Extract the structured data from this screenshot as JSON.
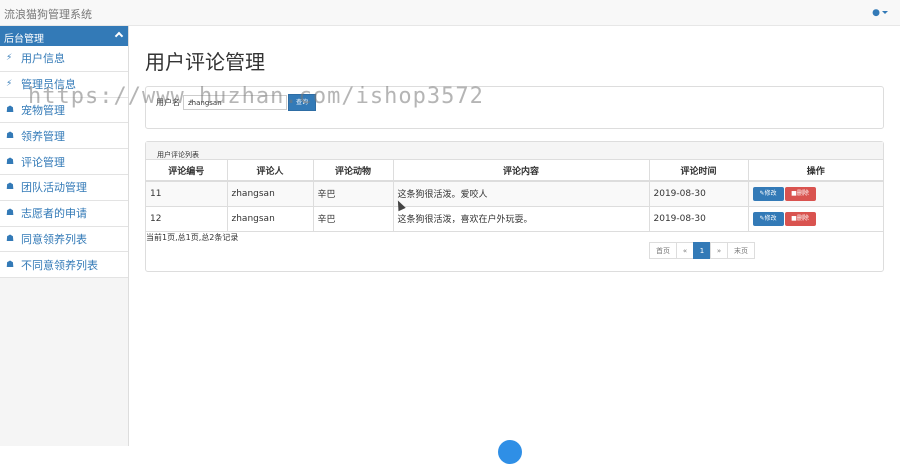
{
  "app": {
    "title": "流浪猫狗管理系统",
    "user_icon": "user-icon"
  },
  "sidebar": {
    "header": "后台管理",
    "items": [
      {
        "label": "用户信息",
        "icon": "bolt-icon"
      },
      {
        "label": "管理员信息",
        "icon": "bolt-icon"
      },
      {
        "label": "宠物管理",
        "icon": "sitemap-icon"
      },
      {
        "label": "领养管理",
        "icon": "sitemap-icon"
      },
      {
        "label": "评论管理",
        "icon": "sitemap-icon"
      },
      {
        "label": "团队活动管理",
        "icon": "sitemap-icon"
      },
      {
        "label": "志愿者的申请",
        "icon": "sitemap-icon"
      },
      {
        "label": "同意领养列表",
        "icon": "sitemap-icon"
      },
      {
        "label": "不同意领养列表",
        "icon": "sitemap-icon"
      }
    ]
  },
  "page": {
    "title": "用户评论管理"
  },
  "search": {
    "label": "用户名",
    "value": "zhangsan",
    "button": "查询"
  },
  "list": {
    "heading": "用户评论列表",
    "columns": [
      "评论编号",
      "评论人",
      "评论动物",
      "评论内容",
      "评论时间",
      "操作"
    ],
    "rows": [
      {
        "id": "11",
        "user": "zhangsan",
        "animal": "辛巴",
        "content": "这条狗很活泼。爱咬人",
        "time": "2019-08-30"
      },
      {
        "id": "12",
        "user": "zhangsan",
        "animal": "辛巴",
        "content": "这条狗很活泼，喜欢在户外玩耍。",
        "time": "2019-08-30"
      }
    ],
    "edit_label": "修改",
    "delete_label": "删除",
    "page_info": "当前1页,总1页,总2条记录",
    "pager": {
      "first": "首页",
      "prev": "«",
      "current": "1",
      "next": "»",
      "last": "末页"
    }
  },
  "watermark": "https://www.huzhan.com/ishop3572",
  "colors": {
    "primary": "#337ab7",
    "danger": "#d9534f"
  }
}
